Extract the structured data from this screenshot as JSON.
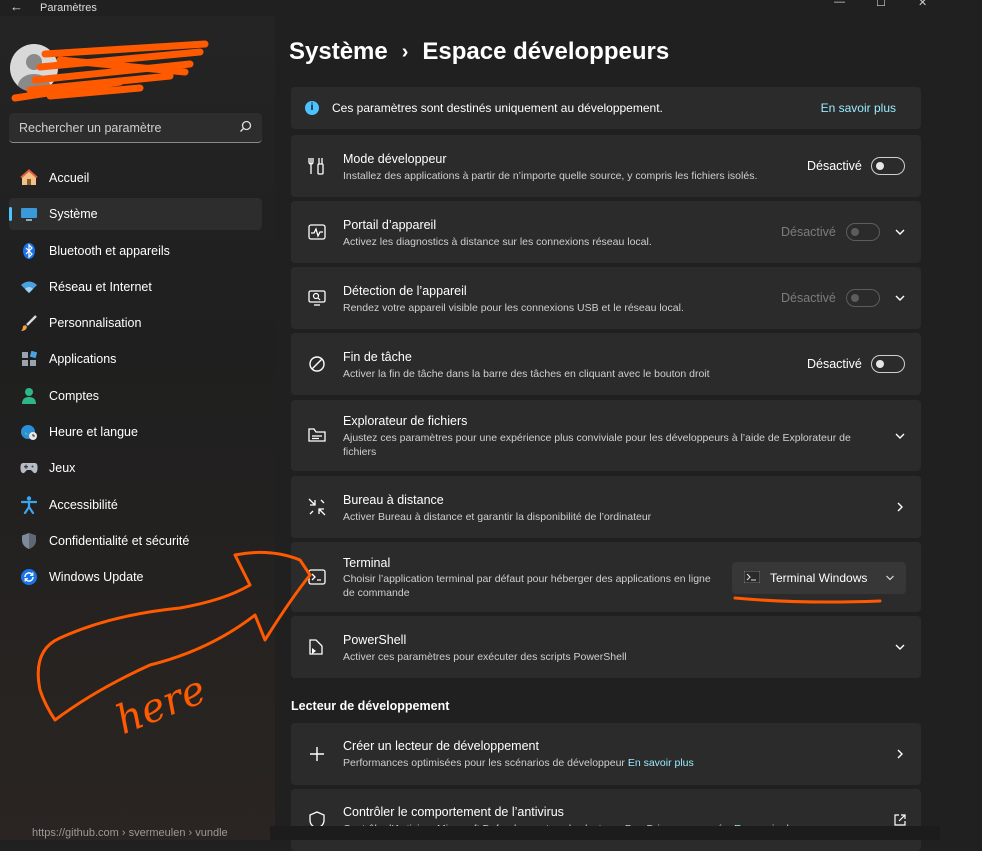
{
  "window": {
    "title": "Paramètres",
    "back_glyph": "←",
    "minimize_glyph": "—",
    "maximize_glyph": "☐",
    "close_glyph": "✕"
  },
  "sidebar": {
    "search_placeholder": "Rechercher un paramètre",
    "items": [
      {
        "label": "Accueil",
        "icon": "home-icon",
        "selected": false
      },
      {
        "label": "Système",
        "icon": "monitor-icon",
        "selected": true
      },
      {
        "label": "Bluetooth et appareils",
        "icon": "bluetooth-icon",
        "selected": false
      },
      {
        "label": "Réseau et Internet",
        "icon": "wifi-icon",
        "selected": false
      },
      {
        "label": "Personnalisation",
        "icon": "brush-icon",
        "selected": false
      },
      {
        "label": "Applications",
        "icon": "apps-icon",
        "selected": false
      },
      {
        "label": "Comptes",
        "icon": "person-icon",
        "selected": false
      },
      {
        "label": "Heure et langue",
        "icon": "globe-clock-icon",
        "selected": false
      },
      {
        "label": "Jeux",
        "icon": "gamepad-icon",
        "selected": false
      },
      {
        "label": "Accessibilité",
        "icon": "accessibility-icon",
        "selected": false
      },
      {
        "label": "Confidentialité et sécurité",
        "icon": "shield-icon",
        "selected": false
      },
      {
        "label": "Windows Update",
        "icon": "update-icon",
        "selected": false
      }
    ]
  },
  "header": {
    "parent": "Système",
    "separator": "›",
    "current": "Espace développeurs"
  },
  "infobar": {
    "text": "Ces paramètres sont destinés uniquement au développement.",
    "link": "En savoir plus",
    "icon_glyph": "i"
  },
  "settings": [
    {
      "title": "Mode développeur",
      "desc": "Installez des applications à partir de n’importe quelle source, y compris les fichiers isolés.",
      "state": "Désactivé",
      "icon": "developer-tools-icon"
    },
    {
      "title": "Portail d’appareil",
      "desc": "Activez les diagnostics à distance sur les connexions réseau local.",
      "state": "Désactivé",
      "icon": "device-portal-icon"
    },
    {
      "title": "Détection de l’appareil",
      "desc": "Rendez votre appareil visible pour les connexions USB et le réseau local.",
      "state": "Désactivé",
      "icon": "device-discovery-icon"
    },
    {
      "title": "Fin de tâche",
      "desc": "Activer la fin de tâche dans la barre des tâches en cliquant avec le bouton droit",
      "state": "Désactivé",
      "icon": "end-task-icon"
    },
    {
      "title": "Explorateur de fichiers",
      "desc": "Ajustez ces paramètres pour une expérience plus conviviale pour les développeurs à l’aide de Explorateur de fichiers",
      "icon": "folder-icon"
    },
    {
      "title": "Bureau à distance",
      "desc": "Activer Bureau à distance et garantir la disponibilité de l’ordinateur",
      "icon": "remote-desktop-icon"
    },
    {
      "title": "Terminal",
      "desc": "Choisir l’application terminal par défaut pour héberger des applications en ligne de commande",
      "dropdown_value": "Terminal Windows",
      "icon": "terminal-icon"
    },
    {
      "title": "PowerShell",
      "desc": "Activer ces paramètres pour exécuter des scripts PowerShell",
      "icon": "powershell-icon"
    }
  ],
  "dev_drive": {
    "section_title": "Lecteur de développement",
    "items": [
      {
        "title": "Créer un lecteur de développement",
        "desc": "Performances optimisées pour les scénarios de développeur",
        "link": "En savoir plus",
        "icon": "plus-icon"
      },
      {
        "title": "Contrôler le comportement de l’antivirus",
        "desc": "Contrôle d’Antivirus Microsoft Defender sur tous les lecteurs Dev Drives approuvés.",
        "link": "En savoir plus",
        "icon": "shield-icon"
      }
    ]
  },
  "annotation": {
    "handwritten_text": "here",
    "color": "#ff5a00"
  },
  "statusbar": {
    "url": "https://github.com › svermeulen › vundle"
  },
  "colors": {
    "accent": "#4cc2ff",
    "link": "#99ebff",
    "card": "#2b2b2b",
    "background": "#202020"
  }
}
